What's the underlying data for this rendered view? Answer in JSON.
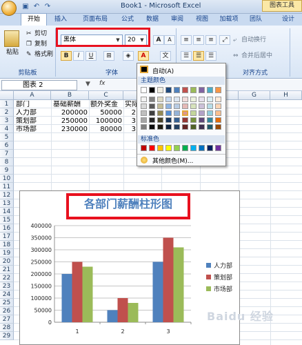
{
  "window": {
    "title": "Book1 - Microsoft Excel",
    "context_tab": "图表工具"
  },
  "tabs": [
    "开始",
    "插入",
    "页面布局",
    "公式",
    "数据",
    "审阅",
    "视图",
    "加载项",
    "团队",
    "设计"
  ],
  "ribbon": {
    "clipboard": {
      "paste": "粘贴",
      "cut": "剪切",
      "copy": "复制",
      "format_painter": "格式刷",
      "label": "剪贴板"
    },
    "font": {
      "name": "黑体",
      "size": "20",
      "grow": "A",
      "shrink": "A",
      "bold": "B",
      "italic": "I",
      "underline": "U",
      "color_a": "A",
      "label": "字体"
    },
    "alignment": {
      "wrap": "自动换行",
      "merge": "合并后居中",
      "label": "对齐方式"
    }
  },
  "namebox": {
    "value": "图表 2",
    "fx": "fx"
  },
  "grid": {
    "columns": [
      "A",
      "B",
      "C",
      "D",
      "E",
      "F",
      "G",
      "H"
    ],
    "rows": [
      "1",
      "2",
      "3",
      "4",
      "5",
      "6",
      "7",
      "8",
      "9",
      "10",
      "11",
      "12",
      "13",
      "14",
      "15",
      "16",
      "17",
      "18",
      "19",
      "20",
      "21",
      "22",
      "23",
      "24",
      "25",
      "26",
      "27",
      "28",
      "29"
    ],
    "cells": [
      [
        "部门",
        "基础薪酬",
        "额外奖金",
        "实际"
      ],
      [
        "人力部",
        "200000",
        "50000",
        "2"
      ],
      [
        "策划部",
        "250000",
        "100000",
        "3"
      ],
      [
        "市场部",
        "230000",
        "80000",
        "3"
      ]
    ]
  },
  "color_menu": {
    "auto": "自动(A)",
    "theme_header": "主题颜色",
    "standard_header": "标准色",
    "more": "其他颜色(M)...",
    "theme_top": [
      "#ffffff",
      "#000000",
      "#eeece1",
      "#1f497d",
      "#4f81bd",
      "#c0504d",
      "#9bbb59",
      "#8064a2",
      "#4bacc6",
      "#f79646"
    ],
    "theme_shades": [
      [
        "#f2f2f2",
        "#7f7f7f",
        "#ddd9c3",
        "#c6d9f0",
        "#dbe5f1",
        "#f2dcdb",
        "#ebf1dd",
        "#e5e0ec",
        "#dbeef3",
        "#fdeada"
      ],
      [
        "#d8d8d8",
        "#595959",
        "#c4bd97",
        "#8db3e2",
        "#b8cce4",
        "#e5b9b7",
        "#d7e3bc",
        "#ccc1d9",
        "#b7dde8",
        "#fbd5b5"
      ],
      [
        "#bfbfbf",
        "#3f3f3f",
        "#938953",
        "#548dd4",
        "#95b3d7",
        "#d99694",
        "#c3d69b",
        "#b2a2c7",
        "#92cddc",
        "#fac08f"
      ],
      [
        "#a5a5a5",
        "#262626",
        "#494429",
        "#17365d",
        "#366092",
        "#953734",
        "#76923c",
        "#5f497a",
        "#31859b",
        "#e36c09"
      ],
      [
        "#7f7f7f",
        "#0c0c0c",
        "#1d1b10",
        "#0f243e",
        "#244061",
        "#632423",
        "#4f6128",
        "#3f3151",
        "#205867",
        "#974806"
      ]
    ],
    "standard": [
      "#c00000",
      "#ff0000",
      "#ffc000",
      "#ffff00",
      "#92d050",
      "#00b050",
      "#00b0f0",
      "#0070c0",
      "#002060",
      "#7030a0"
    ]
  },
  "chart_data": {
    "type": "bar",
    "title": "各部门薪酬柱形图",
    "categories": [
      "1",
      "2",
      "3"
    ],
    "series": [
      {
        "name": "人力部",
        "color": "#4f81bd",
        "values": [
          200000,
          50000,
          250000
        ]
      },
      {
        "name": "策划部",
        "color": "#c0504d",
        "values": [
          250000,
          100000,
          350000
        ]
      },
      {
        "name": "市场部",
        "color": "#9bbb59",
        "values": [
          230000,
          80000,
          310000
        ]
      }
    ],
    "ylim": [
      0,
      400000
    ],
    "yticks": [
      "400000",
      "350000",
      "300000",
      "250000",
      "200000",
      "150000",
      "100000",
      "50000",
      "0"
    ],
    "grid": true,
    "legend": "right"
  },
  "watermark": "Baidu 经验"
}
